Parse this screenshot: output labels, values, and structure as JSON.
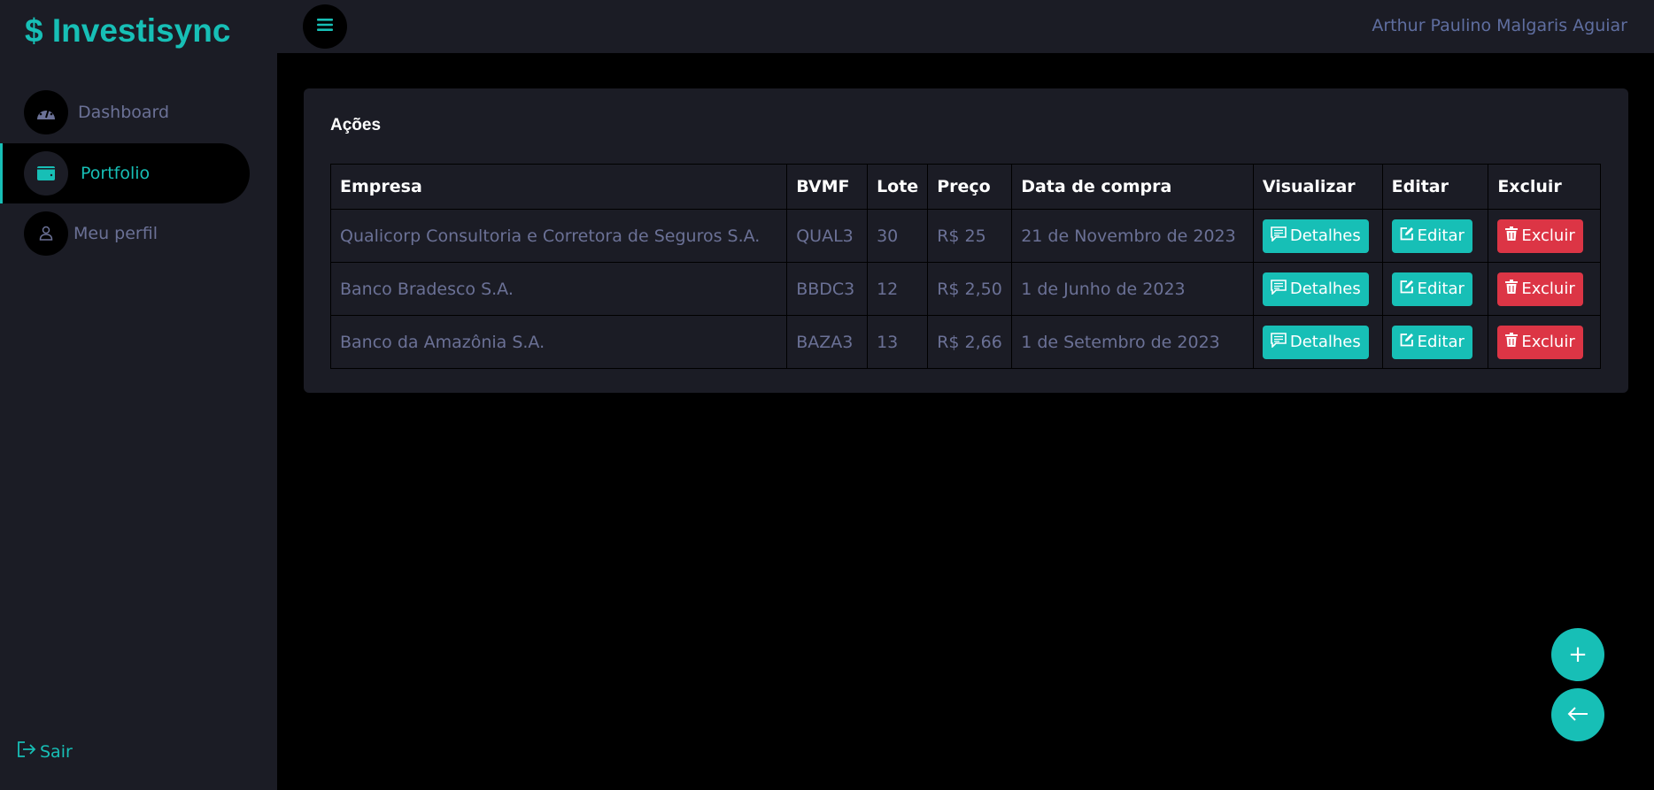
{
  "app": {
    "logo": "$ Investisync",
    "user": "Arthur Paulino Malgaris Aguiar"
  },
  "sidebar": {
    "items": [
      {
        "label": "Dashboard",
        "icon": "gauge-icon"
      },
      {
        "label": "Portfolio",
        "icon": "wallet-icon"
      },
      {
        "label": "Meu perfil",
        "icon": "user-icon"
      }
    ],
    "logout": "Sair"
  },
  "card": {
    "title": "Ações",
    "headers": [
      "Empresa",
      "BVMF",
      "Lote",
      "Preço",
      "Data de compra",
      "Visualizar",
      "Editar",
      "Excluir"
    ],
    "rows": [
      {
        "empresa": "Qualicorp Consultoria e Corretora de Seguros S.A.",
        "bvmf": "QUAL3",
        "lote": "30",
        "preco": "R$ 25",
        "data": "21 de Novembro de 2023",
        "view": "Detalhes",
        "edit": "Editar",
        "del": "Excluir"
      },
      {
        "empresa": "Banco Bradesco S.A.",
        "bvmf": "BBDC3",
        "lote": "12",
        "preco": "R$ 2,50",
        "data": "1 de Junho de 2023",
        "view": "Detalhes",
        "edit": "Editar",
        "del": "Excluir"
      },
      {
        "empresa": "Banco da Amazônia S.A.",
        "bvmf": "BAZA3",
        "lote": "13",
        "preco": "R$ 2,66",
        "data": "1 de Setembro de 2023",
        "view": "Detalhes",
        "edit": "Editar",
        "del": "Excluir"
      }
    ]
  },
  "fab": {
    "add": "+"
  },
  "colors": {
    "accent": "#17bfb6",
    "danger": "#dc3545"
  }
}
